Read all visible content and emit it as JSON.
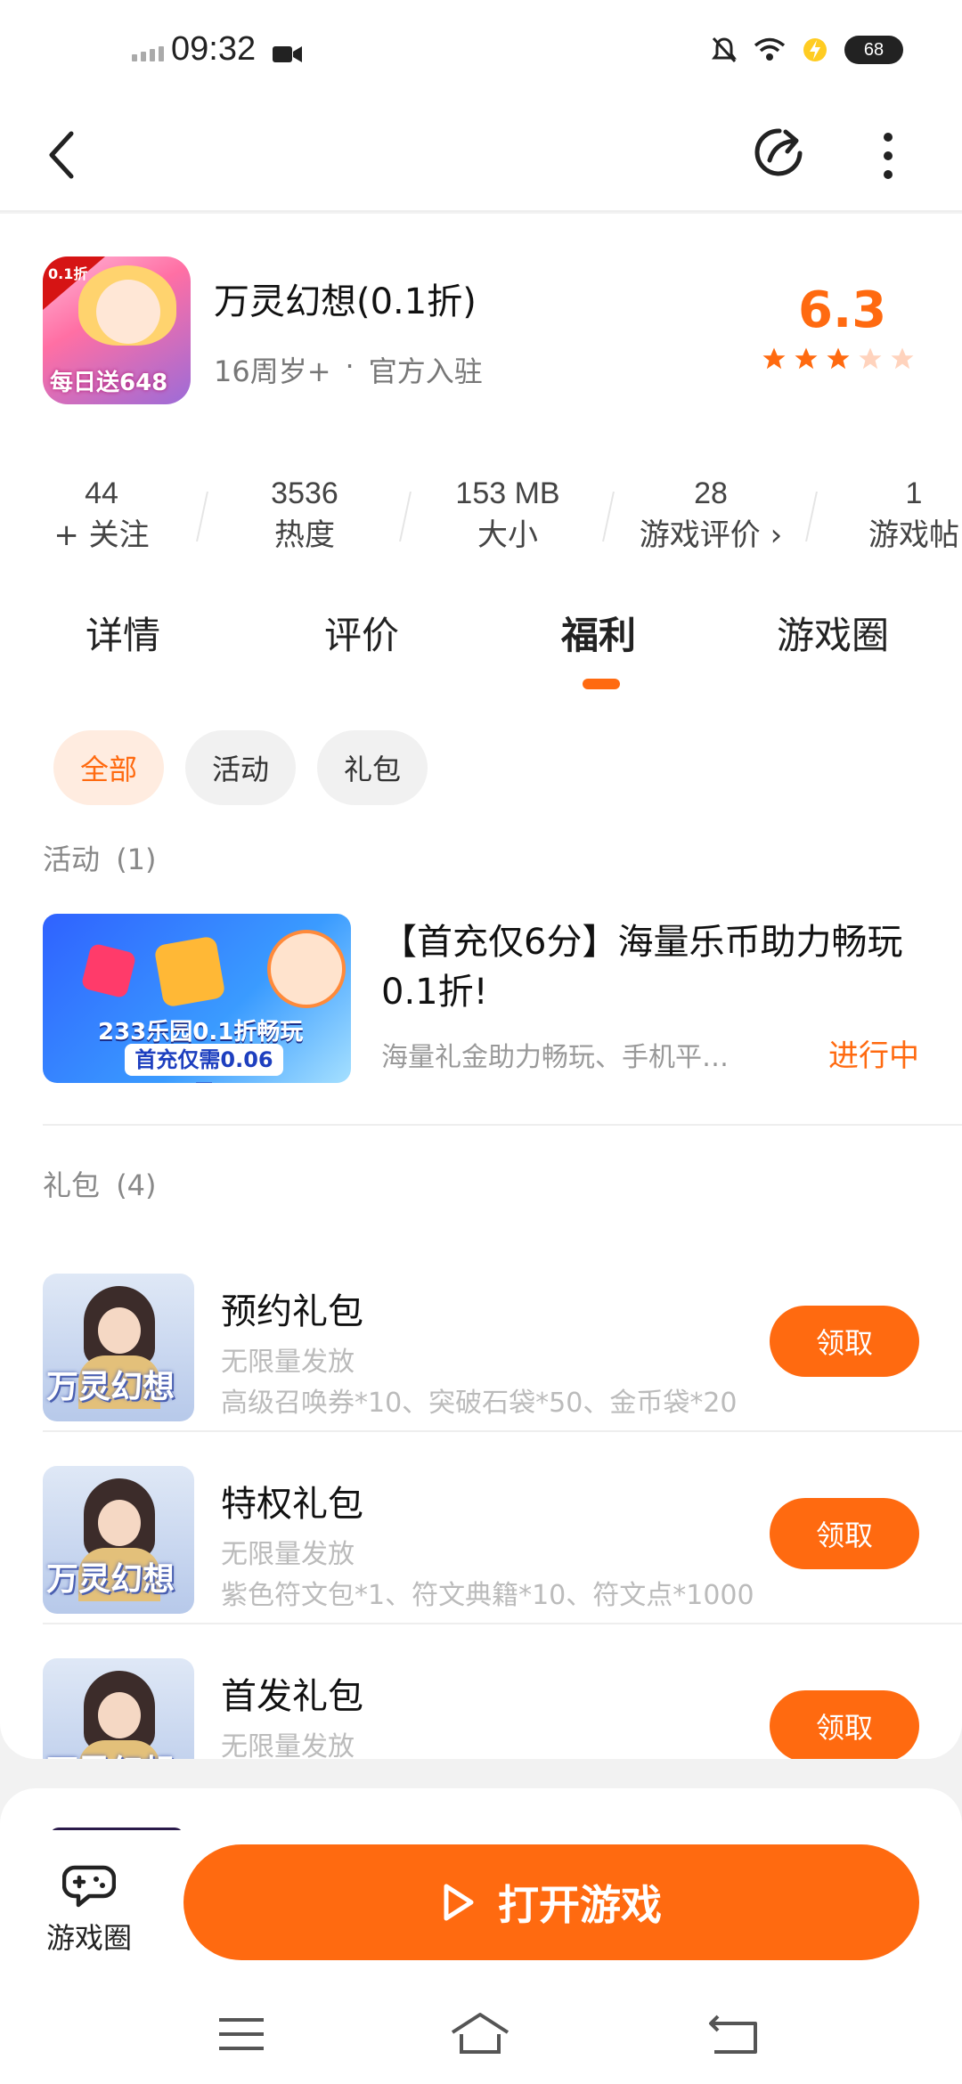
{
  "status_bar": {
    "time": "09:32",
    "battery": "68"
  },
  "app": {
    "title": "万灵幻想(0.1折)",
    "age": "16周岁+",
    "separator": "·",
    "source": "官方入驻",
    "icon_badge": "0.1折",
    "icon_caption": "每日送648",
    "rating": "6.3",
    "stars_filled": 3,
    "stars_total": 5
  },
  "stats": [
    {
      "value": "44",
      "label": "+ 关注"
    },
    {
      "value": "3536",
      "label": "热度"
    },
    {
      "value": "153  MB",
      "label": "大小"
    },
    {
      "value": "28",
      "label": "游戏评价 ›"
    },
    {
      "value": "1",
      "label": "游戏帖"
    }
  ],
  "tabs": [
    "详情",
    "评价",
    "福利",
    "游戏圈"
  ],
  "active_tab": "福利",
  "filters": [
    "全部",
    "活动",
    "礼包"
  ],
  "activity_section": {
    "title": "活动",
    "count": "(1)"
  },
  "activity": {
    "title": "【首充仅6分】海量乐币助力畅玩0.1折!",
    "desc": "海量礼金助力畅玩、手机平…",
    "status": "进行中",
    "banner_line1": "233乐园0.1折畅玩",
    "banner_line2": "首充仅需0.06元"
  },
  "gift_section": {
    "title": "礼包",
    "count": "(4)"
  },
  "gifts": [
    {
      "name": "预约礼包",
      "limit": "无限量发放",
      "items": "高级召唤券*10、突破石袋*50、金币袋*20",
      "button": "领取",
      "logo": "万灵幻想"
    },
    {
      "name": "特权礼包",
      "limit": "无限量发放",
      "items": "紫色符文包*1、符文典籍*10、符文点*1000",
      "button": "领取",
      "logo": "万灵幻想"
    },
    {
      "name": "首发礼包",
      "limit": "无限量发放",
      "items": "",
      "button": "领取",
      "logo": "万灵幻想"
    }
  ],
  "bottom": {
    "circle_label": "游戏圈",
    "open_button": "打开游戏"
  },
  "colors": {
    "accent": "#ff6a10",
    "chip_active_bg": "#ffece0"
  }
}
